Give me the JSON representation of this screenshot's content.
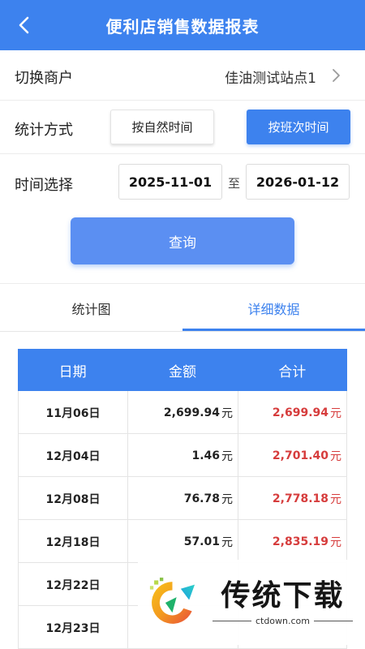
{
  "header": {
    "title": "便利店销售数据报表",
    "back_icon": "chevron-left-icon"
  },
  "merchant": {
    "label": "切换商户",
    "value": "佳油测试站点1",
    "arrow_icon": "chevron-right-icon"
  },
  "stat_mode": {
    "label": "统计方式",
    "options": [
      "按自然时间",
      "按班次时间"
    ],
    "selected": "按班次时间"
  },
  "time": {
    "label": "时间选择",
    "start": "2025-11-01",
    "separator": "至",
    "end": "2026-01-12"
  },
  "query_button": "查询",
  "tabs": [
    {
      "label": "统计图"
    },
    {
      "label": "详细数据",
      "active": true
    }
  ],
  "table": {
    "headers": [
      "日期",
      "金额",
      "合计"
    ],
    "unit": "元",
    "rows": [
      {
        "date": "11月06日",
        "amount": "2,699.94",
        "total": "2,699.94"
      },
      {
        "date": "12月04日",
        "amount": "1.46",
        "total": "2,701.40"
      },
      {
        "date": "12月08日",
        "amount": "76.78",
        "total": "2,778.18"
      },
      {
        "date": "12月18日",
        "amount": "57.01",
        "total": "2,835.19"
      },
      {
        "date": "12月22日",
        "amount": "",
        "total": ""
      },
      {
        "date": "12月23日",
        "amount": "",
        "total": ""
      }
    ]
  },
  "watermark": {
    "brand": "传统下载",
    "domain": "ctdown.com"
  },
  "colors": {
    "primary": "#3d82ee",
    "query_button": "#5b8ff2",
    "total_text": "#d63c3c"
  }
}
